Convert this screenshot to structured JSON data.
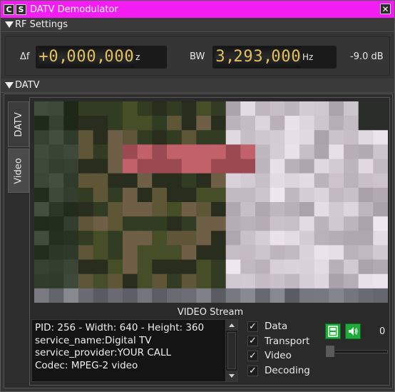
{
  "window": {
    "title": "DATV Demodulator",
    "btn_c": "C",
    "btn_s": "S",
    "accent_color": "#f31cf3"
  },
  "rf_settings": {
    "header": "RF Settings",
    "delta_f_label": "Δf",
    "delta_f_digits": [
      "+",
      "0",
      ",",
      "0",
      "0",
      "0",
      ",",
      "0",
      "0",
      "0"
    ],
    "delta_f_unit": "z",
    "bw_label": "BW",
    "bw_digits": [
      "3",
      ",",
      "2",
      "9",
      "3",
      ",",
      "0",
      "0",
      "0"
    ],
    "bw_unit": "Hz",
    "power": "-9.0 dB"
  },
  "datv": {
    "header": "DATV",
    "tabs": [
      {
        "label": "DATV",
        "active": false
      },
      {
        "label": "Video",
        "active": true
      }
    ],
    "stream_title": "VIDEO Stream",
    "info_lines": [
      "PID: 256 - Width: 640 - Height: 360",
      "service_name:Digital TV",
      "service_provider:YOUR CALL",
      "Codec: MPEG-2 video"
    ],
    "checkboxes": [
      {
        "label": "Data",
        "checked": true
      },
      {
        "label": "Transport",
        "checked": true
      },
      {
        "label": "Video",
        "checked": true
      },
      {
        "label": "Decoding",
        "checked": true
      }
    ],
    "fullscreen_icon": "fullscreen-icon",
    "audio_icon": "speaker-icon",
    "audio_counter": "0",
    "volume_level": 0
  }
}
